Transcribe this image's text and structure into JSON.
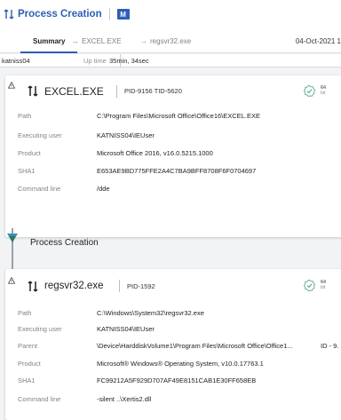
{
  "header": {
    "title": "Process Creation",
    "badge": "M"
  },
  "tabs": [
    {
      "label": "Summary"
    },
    {
      "label": "EXCEL.EXE"
    },
    {
      "label": "regsvr32.exe"
    }
  ],
  "date": "04-Oct-2021 1",
  "userbar": {
    "user": "katniss04",
    "uptime_label": "Up time",
    "uptime_value": "35min, 34sec"
  },
  "card1": {
    "name": "EXCEL.EXE",
    "pids": "PID-9156  TID-5620",
    "bits_num": "64",
    "bits_unit": "bit",
    "rows": [
      {
        "label": "Path",
        "value": "C:\\Program Files\\Microsoft Office\\Office16\\EXCEL.EXE"
      },
      {
        "label": "Executing user",
        "value": "KATNISS04\\IEUser"
      },
      {
        "label": "Product",
        "value": "Microsoft Office 2016, v16.0.5215.1000"
      },
      {
        "label": "SHA1",
        "value": "E653AE9BD775FFE2A4C7BA9BFF8708F6F0704697"
      },
      {
        "label": "Command line",
        "value": "/dde"
      }
    ]
  },
  "timeline": {
    "label": "Process Creation"
  },
  "card2": {
    "name": "regsvr32.exe",
    "pids": "PID-1592",
    "bits_num": "64",
    "bits_unit": "bit",
    "rows": [
      {
        "label": "Path",
        "value": "C:\\Windows\\System32\\regsvr32.exe"
      },
      {
        "label": "Executing user",
        "value": "KATNISS04\\IEUser"
      },
      {
        "label": "Parent",
        "value": "\\Device\\HarddiskVolume1\\Program Files\\Microsoft Office\\Office1...",
        "extra": "ID - 9."
      },
      {
        "label": "Product",
        "value": "Microsoft® Windows® Operating System, v10.0.17763.1"
      },
      {
        "label": "SHA1",
        "value": "FC99212A5F929D707AF49E8151CAB1E30FF658EB"
      },
      {
        "label": "Command line",
        "value": "-silent ..\\Xertis2.dll"
      }
    ]
  },
  "colors": {
    "accent": "#2f5fb3",
    "check": "#5aa585",
    "timeline_dot": "#3a8db0"
  }
}
